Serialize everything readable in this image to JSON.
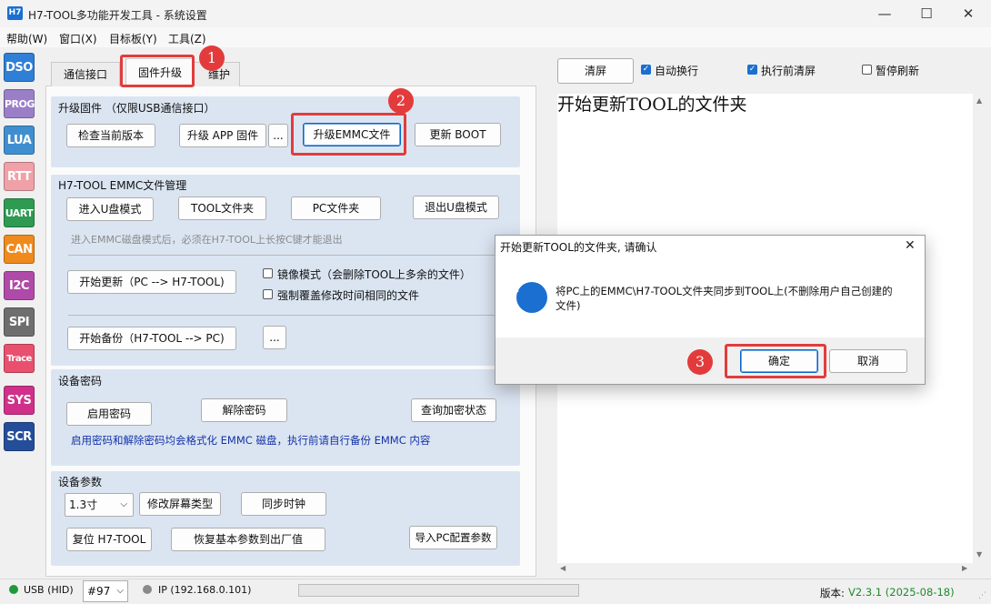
{
  "window": {
    "icon_text": "H7",
    "title": "H7-TOOL多功能开发工具 - 系统设置",
    "minimize": "—",
    "maximize": "☐",
    "close": "✕"
  },
  "menu": [
    "帮助(W)",
    "窗口(X)",
    "目标板(Y)",
    "工具(Z)"
  ],
  "sidebar": [
    {
      "label": "DSO",
      "color": "#2f7fd6"
    },
    {
      "label": "PROG",
      "color": "#9a7fc8"
    },
    {
      "label": "LUA",
      "color": "#3f8fd0"
    },
    {
      "label": "RTT",
      "color": "#f0a0a8"
    },
    {
      "label": "UART",
      "color": "#2e9a52"
    },
    {
      "label": "CAN",
      "color": "#ee8a1e"
    },
    {
      "label": "I2C",
      "color": "#b04aa8"
    },
    {
      "label": "SPI",
      "color": "#6e6e6e"
    },
    {
      "label": "Trace",
      "color": "#e8506e"
    },
    {
      "label": "SYS",
      "color": "#d0308a"
    },
    {
      "label": "SCR",
      "color": "#244e9a"
    }
  ],
  "tabs": [
    "通信接口",
    "固件升级",
    "维护"
  ],
  "firmware": {
    "title": "升级固件 （仅限USB通信接口）",
    "check_version": "检查当前版本",
    "upgrade_app": "升级 APP 固件",
    "more": "...",
    "upgrade_emmc": "升级EMMC文件",
    "update_boot": "更新 BOOT"
  },
  "emmc": {
    "title": "H7-TOOL EMMC文件管理",
    "enter_udisk": "进入U盘模式",
    "tool_folder": "TOOL文件夹",
    "pc_folder": "PC文件夹",
    "exit_udisk": "退出U盘模式",
    "hint": "进入EMMC磁盘模式后，必须在H7-TOOL上长按C键才能退出",
    "start_update": "开始更新（PC --> H7-TOOL)",
    "mirror_mode": "镜像模式（会删除TOOL上多余的文件）",
    "force_overwrite": "强制覆盖修改时间相同的文件",
    "start_backup": "开始备份（H7-TOOL --> PC)",
    "more": "..."
  },
  "password": {
    "title": "设备密码",
    "enable": "启用密码",
    "remove": "解除密码",
    "query": "查询加密状态",
    "note": "启用密码和解除密码均会格式化 EMMC 磁盘，执行前请自行备份 EMMC 内容"
  },
  "params": {
    "title": "设备参数",
    "screen_size": "1.3寸",
    "change_screen": "修改屏幕类型",
    "sync_clock": "同步时钟",
    "reset": "复位 H7-TOOL",
    "restore": "恢复基本参数到出厂值",
    "import": "导入PC配置参数"
  },
  "console": {
    "clear": "清屏",
    "auto_wrap": "自动换行",
    "clear_before": "执行前清屏",
    "pause_refresh": "暂停刷新",
    "text": "开始更新TOOL的文件夹"
  },
  "dialog": {
    "title": "开始更新TOOL的文件夹, 请确认",
    "message": "将PC上的EMMC\\H7-TOOL文件夹同步到TOOL上(不删除用户自己创建的文件)",
    "ok": "确定",
    "cancel": "取消"
  },
  "annotations": [
    "1",
    "2",
    "3"
  ],
  "status": {
    "usb": "USB (HID)",
    "device": "#97",
    "ip": "IP (192.168.0.101)",
    "version_label": "版本:",
    "version": "V2.3.1 (2025-08-18)"
  },
  "colors": {
    "accent": "#1a6fd1",
    "annotation_red": "#e23c3c",
    "group_bg": "#dbe5f2",
    "status_green": "#1e9a3a",
    "version_green": "#1e8a2a"
  }
}
